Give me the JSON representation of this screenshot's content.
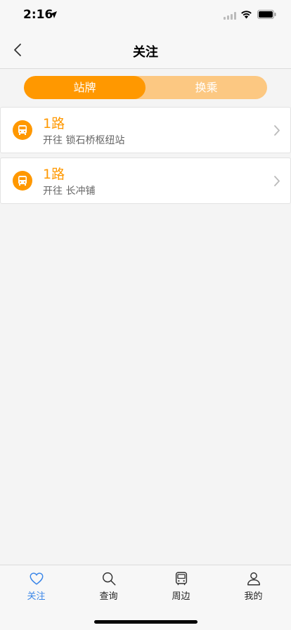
{
  "status": {
    "time": "2:16"
  },
  "nav": {
    "title": "关注"
  },
  "segments": [
    {
      "label": "站牌",
      "active": true
    },
    {
      "label": "换乘",
      "active": false
    }
  ],
  "cards": [
    {
      "route": "1路",
      "direction": "开往 锁石桥枢纽站"
    },
    {
      "route": "1路",
      "direction": "开往 长冲铺"
    }
  ],
  "tabs": [
    {
      "label": "关注",
      "icon": "heart-icon",
      "active": true
    },
    {
      "label": "查询",
      "icon": "search-icon",
      "active": false
    },
    {
      "label": "周边",
      "icon": "bus-icon",
      "active": false
    },
    {
      "label": "我的",
      "icon": "user-icon",
      "active": false
    }
  ],
  "colors": {
    "accent": "#ff9800",
    "accent_light": "#fcc882",
    "tab_active": "#3a86e8"
  }
}
